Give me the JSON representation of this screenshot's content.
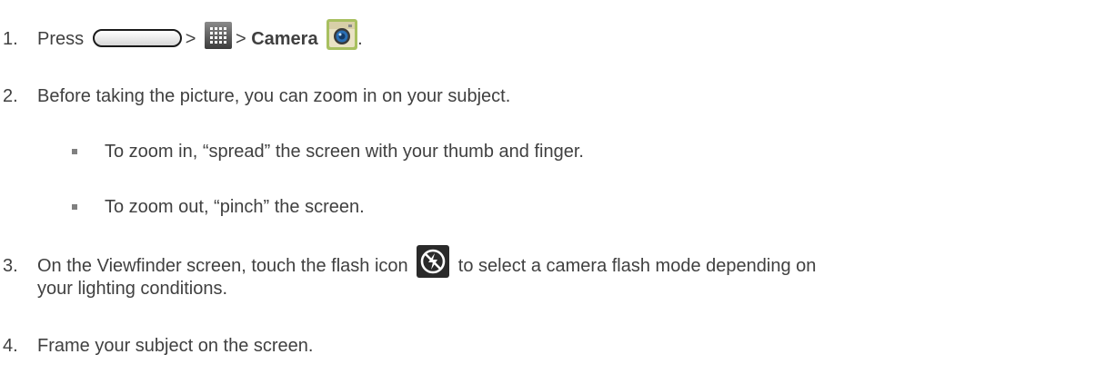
{
  "steps": [
    {
      "number": "1.",
      "press": "Press",
      "sep1": ">",
      "sep2": ">",
      "camera": "Camera",
      "end": "."
    },
    {
      "number": "2.",
      "text": "Before taking the picture, you can zoom in on your subject.",
      "bullets": [
        "To zoom in, “spread” the screen with your thumb and finger.",
        "To zoom out, “pinch” the screen."
      ]
    },
    {
      "number": "3.",
      "text_before": "On the Viewfinder screen, touch the flash icon",
      "text_after": "to select a camera flash mode depending on",
      "text_cont": "your lighting conditions."
    },
    {
      "number": "4.",
      "text": "Frame your subject on the screen."
    }
  ],
  "icons": {
    "home": "home-key-icon",
    "apps": "apps-grid-icon",
    "camera": "camera-app-icon",
    "flash": "flash-off-icon"
  },
  "colors": {
    "text": "#404040",
    "bullet": "#808080"
  }
}
